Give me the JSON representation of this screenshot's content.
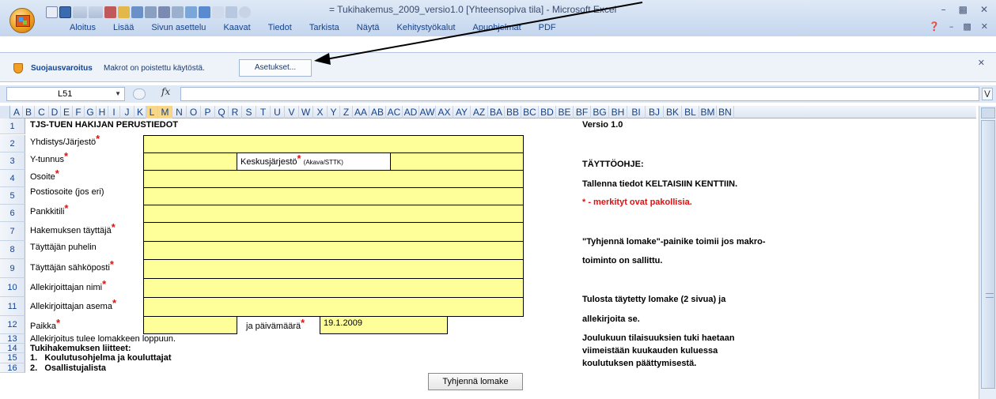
{
  "window": {
    "title": "Tukihakemus_2009_versio1.0 [Yhteensopiva tila] - Microsoft Excel",
    "title_separator": "="
  },
  "ribbon": {
    "tabs": [
      "Aloitus",
      "Lisää",
      "Sivun asettelu",
      "Kaavat",
      "Tiedot",
      "Tarkista",
      "Näytä",
      "Kehitystyökalut",
      "Apuohjelmat",
      "PDF"
    ]
  },
  "security_bar": {
    "title": "Suojausvaroitus",
    "message": "Makrot on poistettu käytöstä.",
    "button": "Asetukset..."
  },
  "formula_bar": {
    "name_box": "L51",
    "fx": "fx",
    "value": ""
  },
  "columns": [
    "A",
    "B",
    "C",
    "D",
    "E",
    "F",
    "G",
    "H",
    "I",
    "J",
    "K",
    "L",
    "M",
    "N",
    "O",
    "P",
    "Q",
    "R",
    "S",
    "T",
    "U",
    "V",
    "W",
    "X",
    "Y",
    "Z",
    "AA",
    "AB",
    "AC",
    "AD",
    "AW",
    "AX",
    "AY",
    "AZ",
    "BA",
    "BB",
    "BC",
    "BD",
    "BE",
    "BF",
    "BG",
    "BH",
    "BI",
    "BJ",
    "BK",
    "BL",
    "BM",
    "BN"
  ],
  "selected_columns": [
    "L",
    "M"
  ],
  "rows": [
    "1",
    "2",
    "3",
    "4",
    "5",
    "6",
    "7",
    "8",
    "9",
    "10",
    "11",
    "12",
    "13",
    "14",
    "15",
    "16"
  ],
  "form": {
    "heading": "TJS-TUEN HAKIJAN PERUSTIEDOT",
    "fields": {
      "yhdistys": "Yhdistys/Järjestö",
      "ytunnus": "Y-tunnus",
      "keskusjarjesto": "Keskusjärjestö",
      "keskusjarjesto_note": "(Akava/STTK)",
      "osoite": "Osoite",
      "postiosoite": "Postiosoite (jos eri)",
      "pankkitili": "Pankkitili",
      "hakemuksen_tayttaja": "Hakemuksen täyttäjä",
      "tayttajan_puhelin": "Täyttäjän puhelin",
      "tayttajan_sahkoposti": "Täyttäjän sähköposti",
      "allekirjoittajan_nimi": "Allekirjoittajan nimi",
      "allekirjoittajan_asema": "Allekirjoittajan asema",
      "paikka": "Paikka",
      "paivamaara_label": "ja päivämäärä",
      "paivamaara_value": "19.1.2009"
    },
    "required_mark": "*",
    "note_signature": "Allekirjoitus tulee lomakkeen loppuun.",
    "attachments_heading": "Tukihakemuksen liitteet:",
    "attachments": [
      {
        "num": "1.",
        "text": "Koulutusohjelma ja kouluttajat"
      },
      {
        "num": "2.",
        "text": "Osallistujalista"
      }
    ],
    "clear_button": "Tyhjennä lomake"
  },
  "instructions": {
    "version": "Versio 1.0",
    "title": "TÄYTTÖOHJE:",
    "line1": "Tallenna tiedot KELTAISIIN KENTTIIN.",
    "required_note": "* - merkityt ovat pakollisia.",
    "macro_line1": "\"Tyhjennä lomake\"-painike toimii jos makro-",
    "macro_line2": "toiminto on sallittu.",
    "print_line1": "Tulosta täytetty lomake (2 sivua) ja",
    "print_line2": "allekirjoita se.",
    "deadline1": "Joulukuun tilaisuuksien tuki haetaan",
    "deadline2": "viimeistään kuukauden kuluessa",
    "deadline3": "koulutuksen päättymisestä."
  },
  "colors": {
    "field_fill": "#ffff99",
    "required_red": "#e01010",
    "ribbon_text": "#15428b"
  }
}
